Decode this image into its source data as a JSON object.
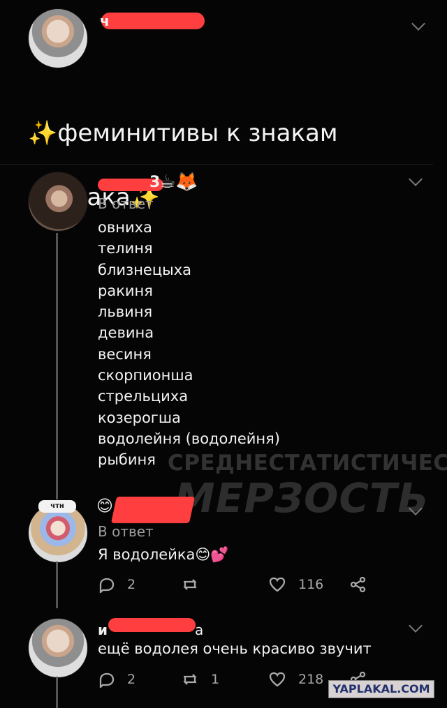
{
  "tweet": {
    "author_visible": "ч",
    "title_line1": "феминитивы к знакам",
    "title_line2": "зодиака",
    "sparkle": "✨"
  },
  "reply1": {
    "author_visible": "3",
    "emoji": "☕🦊",
    "label": "В ответ",
    "body": "овниха\nтелиня\nблизнецыха\nракиня\nльвиня\nдевина\nвесиня\nскорпионша\nстрельциха\nкозерогша\nводолейня (водолейня)\nрыбиня"
  },
  "reply2": {
    "badge": "чтн",
    "author_visible": "",
    "emoji": "😊",
    "label": "В ответ",
    "body": "Я водолейка😊💕",
    "reply_count": "2",
    "like_count": "116"
  },
  "reply3": {
    "author_visible": "и",
    "author_tail": "а",
    "body": "ещё водолея очень красиво звучит",
    "reply_count": "2",
    "retweet_count": "1",
    "like_count": "218"
  },
  "watermark": {
    "line1": "СРЕДНЕСТАТИСТИЧЕСКАЯ",
    "line2": "МЕРЗОСТЬ"
  },
  "site_badge": "YAPLAKAL.COM"
}
